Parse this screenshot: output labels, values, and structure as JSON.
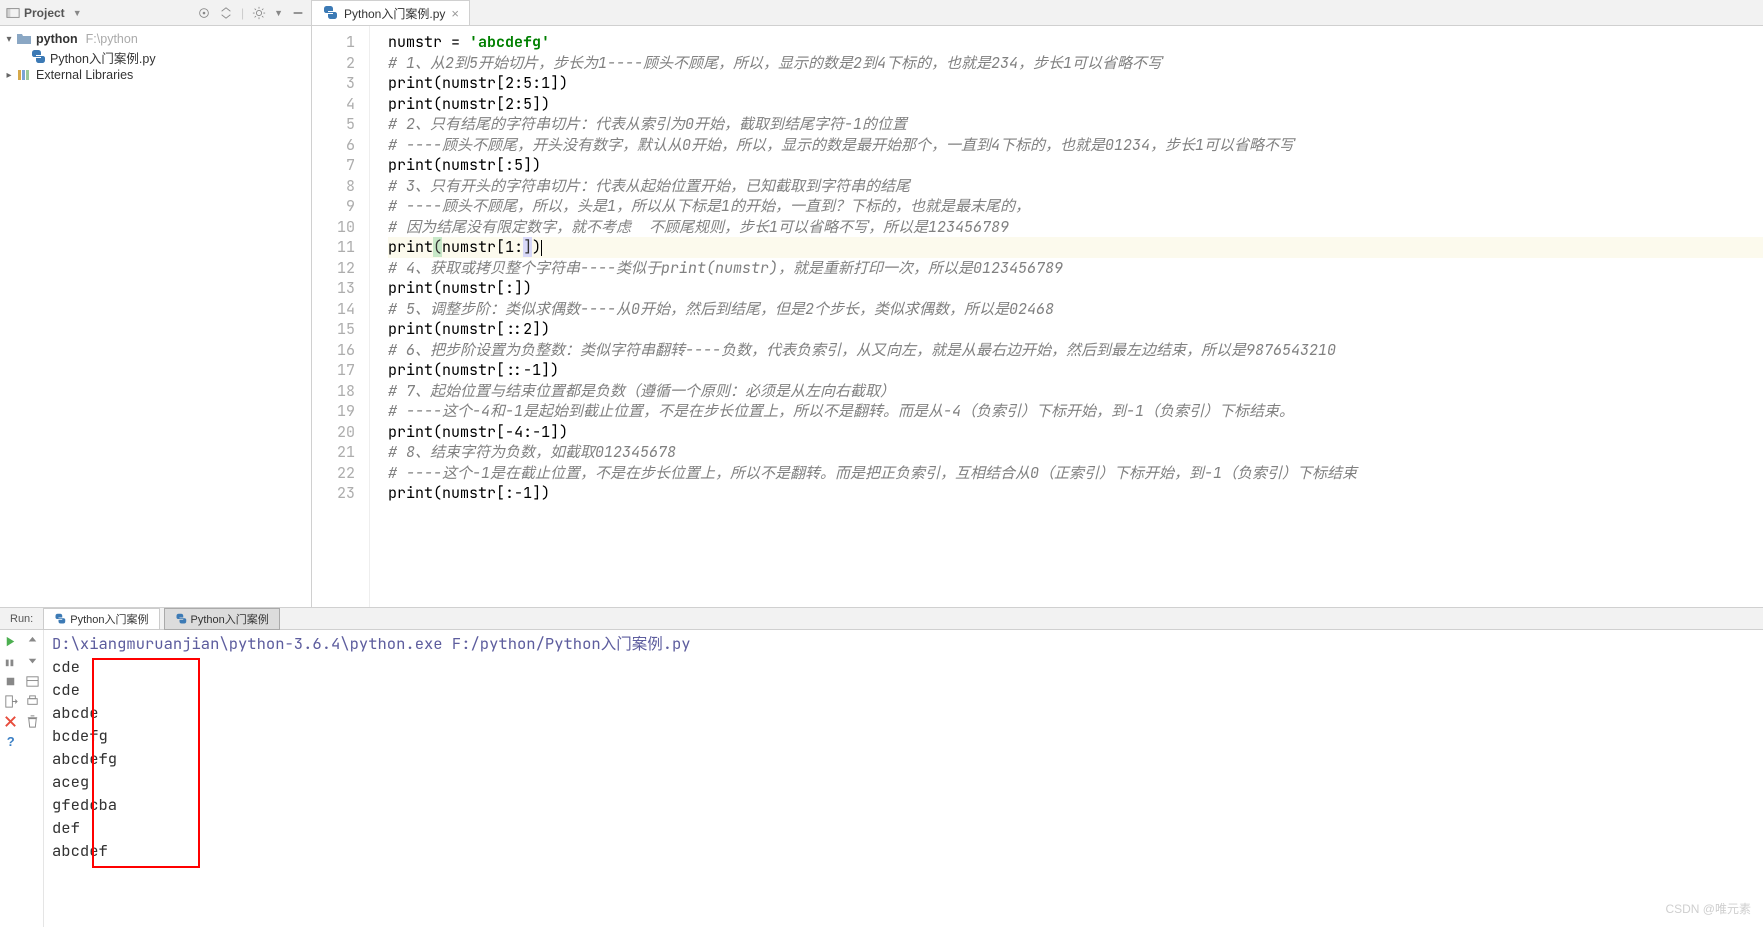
{
  "project": {
    "panel_title": "Project",
    "root": {
      "name": "python",
      "hint": "F:\\python"
    },
    "file": "Python入门案例.py",
    "ext_libs": "External Libraries"
  },
  "tab": {
    "label": "Python入门案例.py"
  },
  "code": {
    "highlighted_line": 11,
    "lines": [
      {
        "n": 1,
        "type": "code",
        "segs": [
          [
            "fn",
            "numstr "
          ],
          [
            "op",
            "= "
          ],
          [
            "str",
            "'abcdefg'"
          ]
        ]
      },
      {
        "n": 2,
        "type": "cm",
        "text": "# 1、从2到5开始切片，步长为1----顾头不顾尾，所以，显示的数是2到4下标的，也就是234，步长1可以省略不写"
      },
      {
        "n": 3,
        "type": "code",
        "segs": [
          [
            "fn",
            "print"
          ],
          [
            "op",
            "("
          ],
          [
            "fn",
            "numstr"
          ],
          [
            "op",
            "["
          ],
          [
            "op",
            "2"
          ],
          [
            "op",
            ":"
          ],
          [
            "op",
            "5"
          ],
          [
            "op",
            ":"
          ],
          [
            "op",
            "1"
          ],
          [
            "op",
            "])"
          ]
        ]
      },
      {
        "n": 4,
        "type": "code",
        "segs": [
          [
            "fn",
            "print"
          ],
          [
            "op",
            "("
          ],
          [
            "fn",
            "numstr"
          ],
          [
            "op",
            "["
          ],
          [
            "op",
            "2"
          ],
          [
            "op",
            ":"
          ],
          [
            "op",
            "5"
          ],
          [
            "op",
            "])"
          ]
        ]
      },
      {
        "n": 5,
        "type": "cm",
        "text": "# 2、只有结尾的字符串切片：代表从索引为0开始，截取到结尾字符-1的位置"
      },
      {
        "n": 6,
        "type": "cm",
        "text": "# ----顾头不顾尾，开头没有数字，默认从0开始，所以，显示的数是最开始那个，一直到4下标的，也就是01234，步长1可以省略不写"
      },
      {
        "n": 7,
        "type": "code",
        "segs": [
          [
            "fn",
            "print"
          ],
          [
            "op",
            "("
          ],
          [
            "fn",
            "numstr"
          ],
          [
            "op",
            "[:"
          ],
          [
            "op",
            "5"
          ],
          [
            "op",
            "])"
          ]
        ]
      },
      {
        "n": 8,
        "type": "cm",
        "text": "# 3、只有开头的字符串切片：代表从起始位置开始，已知截取到字符串的结尾"
      },
      {
        "n": 9,
        "type": "cm",
        "text": "# ----顾头不顾尾，所以，头是1，所以从下标是1的开始，一直到？下标的，也就是最末尾的，"
      },
      {
        "n": 10,
        "type": "cm",
        "text": "# 因为结尾没有限定数字，就不考虑  不顾尾规则，步长1可以省略不写，所以是123456789"
      },
      {
        "n": 11,
        "type": "code-hl",
        "segs": [
          [
            "fn",
            "print"
          ],
          [
            "pa",
            "("
          ],
          [
            "fn",
            "numstr"
          ],
          [
            "op",
            "["
          ],
          [
            "op",
            "1"
          ],
          [
            "op",
            ":"
          ],
          [
            "pb",
            "]"
          ],
          [
            "op",
            ")"
          ],
          [
            "caret",
            ""
          ]
        ]
      },
      {
        "n": 12,
        "type": "cm",
        "text": "# 4、获取或拷贝整个字符串----类似于print(numstr)，就是重新打印一次，所以是0123456789"
      },
      {
        "n": 13,
        "type": "code",
        "segs": [
          [
            "fn",
            "print"
          ],
          [
            "op",
            "("
          ],
          [
            "fn",
            "numstr"
          ],
          [
            "op",
            "[:])"
          ]
        ]
      },
      {
        "n": 14,
        "type": "cm",
        "text": "# 5、调整步阶：类似求偶数----从0开始，然后到结尾，但是2个步长，类似求偶数，所以是02468"
      },
      {
        "n": 15,
        "type": "code",
        "segs": [
          [
            "fn",
            "print"
          ],
          [
            "op",
            "("
          ],
          [
            "fn",
            "numstr"
          ],
          [
            "op",
            "[::"
          ],
          [
            "op",
            "2"
          ],
          [
            "op",
            "])"
          ]
        ]
      },
      {
        "n": 16,
        "type": "cm",
        "text": "# 6、把步阶设置为负整数：类似字符串翻转----负数，代表负索引，从又向左，就是从最右边开始，然后到最左边结束，所以是9876543210"
      },
      {
        "n": 17,
        "type": "code",
        "segs": [
          [
            "fn",
            "print"
          ],
          [
            "op",
            "("
          ],
          [
            "fn",
            "numstr"
          ],
          [
            "op",
            "[::-"
          ],
          [
            "op",
            "1"
          ],
          [
            "op",
            "])"
          ]
        ]
      },
      {
        "n": 18,
        "type": "cm",
        "text": "# 7、起始位置与结束位置都是负数（遵循一个原则：必须是从左向右截取）"
      },
      {
        "n": 19,
        "type": "cm",
        "text": "# ----这个-4和-1是起始到截止位置，不是在步长位置上，所以不是翻转。而是从-4（负索引）下标开始，到-1（负索引）下标结束。"
      },
      {
        "n": 20,
        "type": "code",
        "segs": [
          [
            "fn",
            "print"
          ],
          [
            "op",
            "("
          ],
          [
            "fn",
            "numstr"
          ],
          [
            "op",
            "[-"
          ],
          [
            "op",
            "4"
          ],
          [
            "op",
            ":-"
          ],
          [
            "op",
            "1"
          ],
          [
            "op",
            "])"
          ]
        ]
      },
      {
        "n": 21,
        "type": "cm",
        "text": "# 8、结束字符为负数，如截取012345678"
      },
      {
        "n": 22,
        "type": "cm",
        "text": "# ----这个-1是在截止位置，不是在步长位置上，所以不是翻转。而是把正负索引，互相结合从0（正索引）下标开始，到-1（负索引）下标结束"
      },
      {
        "n": 23,
        "type": "code",
        "segs": [
          [
            "fn",
            "print"
          ],
          [
            "op",
            "("
          ],
          [
            "fn",
            "numstr"
          ],
          [
            "op",
            "[:-"
          ],
          [
            "op",
            "1"
          ],
          [
            "op",
            "])"
          ]
        ]
      }
    ]
  },
  "run": {
    "label": "Run:",
    "tab1": "Python入门案例",
    "tab2": "Python入门案例",
    "cmd": "D:\\xiangmuruanjian\\python-3.6.4\\python.exe F:/python/Python入门案例.py",
    "output": [
      "cde",
      "cde",
      "abcde",
      "bcdefg",
      "abcdefg",
      "aceg",
      "gfedcba",
      "def",
      "abcdef"
    ]
  },
  "watermark": "CSDN @唯元素"
}
